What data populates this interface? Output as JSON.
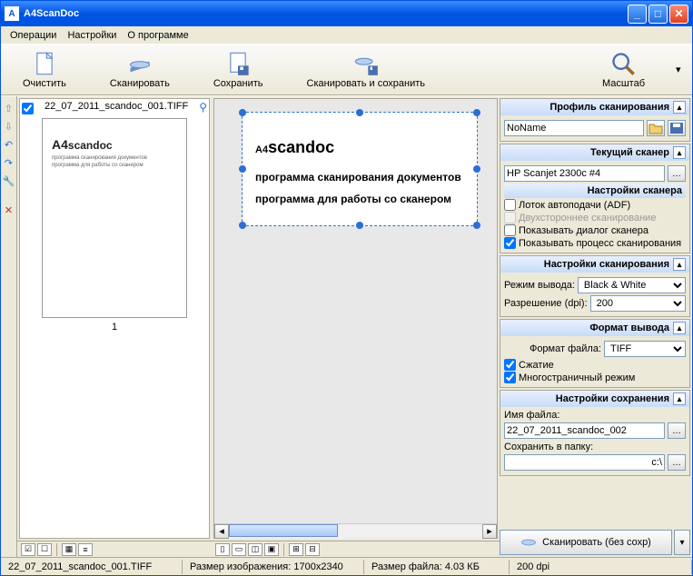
{
  "window": {
    "title": "A4ScanDoc"
  },
  "menu": {
    "operations": "Операции",
    "settings": "Настройки",
    "about": "О программе"
  },
  "toolbar": {
    "clear": "Очистить",
    "scan": "Сканировать",
    "save": "Сохранить",
    "scan_save": "Сканировать и сохранить",
    "zoom": "Масштаб"
  },
  "thumb": {
    "filename": "22_07_2011_scandoc_001.TIFF",
    "page": "1",
    "logo_big": "A4",
    "logo_small": "scandoc",
    "line1": "программа сканирования  документов",
    "line2": "программа для работы со сканером"
  },
  "preview": {
    "logo_big": "A4",
    "logo_small": "scandoc",
    "line1": "программа сканирования  документов",
    "line2": "программа для работы со сканером"
  },
  "panels": {
    "profile": {
      "title": "Профиль сканирования",
      "value": "NoName"
    },
    "scanner": {
      "title": "Текущий сканер",
      "value": "HP Scanjet 2300c #4",
      "settings_head": "Настройки сканера",
      "adf": "Лоток автоподачи (ADF)",
      "duplex": "Двухстороннее сканирование",
      "dialog": "Показывать диалог сканера",
      "progress": "Показывать процесс сканирования"
    },
    "scan_settings": {
      "title": "Настройки сканирования",
      "mode_label": "Режим вывода:",
      "mode_value": "Black & White",
      "dpi_label": "Разрешение (dpi):",
      "dpi_value": "200"
    },
    "output": {
      "title": "Формат вывода",
      "format_label": "Формат файла:",
      "format_value": "TIFF",
      "compress": "Сжатие",
      "multipage": "Многостраничный режим"
    },
    "save": {
      "title": "Настройки сохранения",
      "name_label": "Имя файла:",
      "name_value": "22_07_2011_scandoc_002",
      "folder_label": "Сохранить в папку:",
      "folder_value": "c:\\"
    },
    "scan_button": "Сканировать (без сохр)"
  },
  "status": {
    "file": "22_07_2011_scandoc_001.TIFF",
    "dims_label": "Размер изображения:",
    "dims_value": "1700x2340",
    "size_label": "Размер файла:",
    "size_value": "4.03 КБ",
    "dpi": "200 dpi"
  }
}
